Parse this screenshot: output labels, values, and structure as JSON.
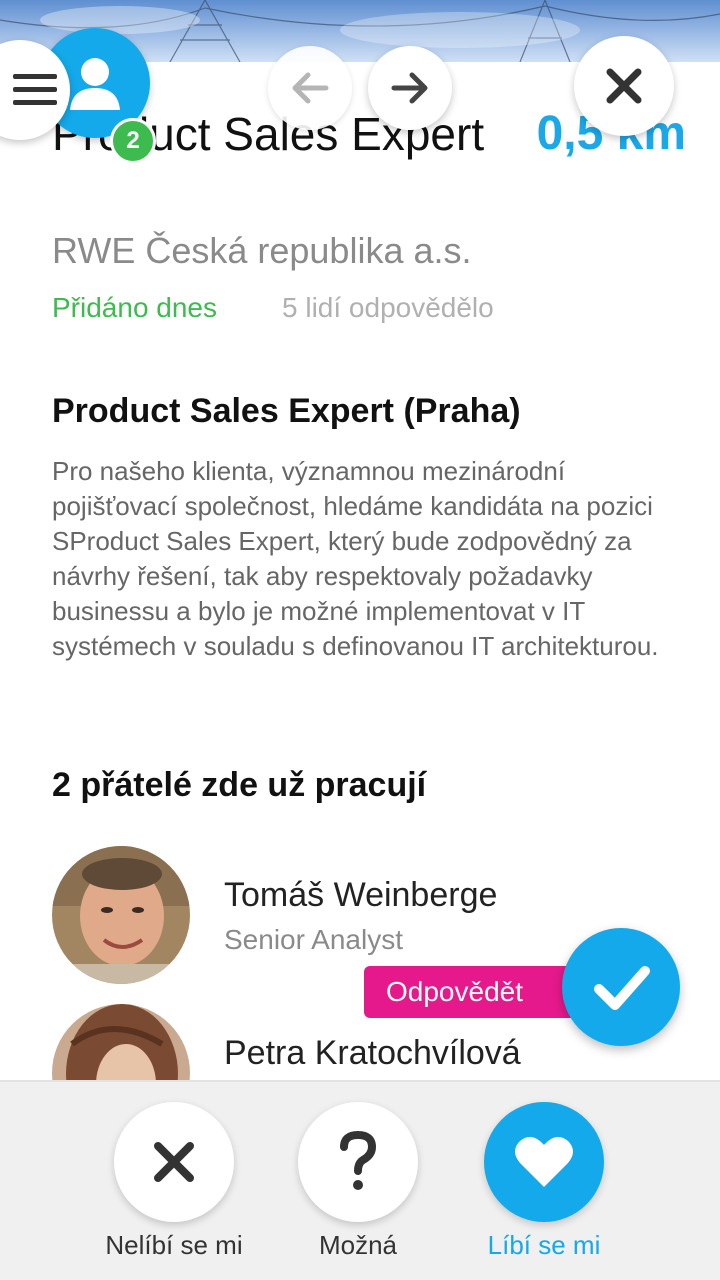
{
  "job": {
    "title": "Product Sales Expert",
    "distance": "0,5 km",
    "company": "RWE Česká republika a.s.",
    "added": "Přidáno dnes",
    "responses": "5 lidí odpovědělo",
    "heading": "Product Sales Expert (Praha)",
    "description": "Pro našeho klienta, významnou mezinárodní pojišťovací společnost, hledáme kandidáta na pozici SProduct Sales Expert, který bude zodpovědný za návrhy řešení, tak aby respektovaly požadavky businessu a bylo je možné implementovat v IT systémech v souladu s definovanou IT architekturou."
  },
  "friends": {
    "heading": "2 přátelé zde už pracují",
    "items": [
      {
        "name": "Tomáš Weinberge",
        "role": "Senior Analyst"
      },
      {
        "name": "Petra Kratochvílová",
        "role": ""
      }
    ]
  },
  "header": {
    "notification_count": "2",
    "icons": [
      "menu-icon",
      "user-icon",
      "arrow-left-icon",
      "arrow-right-icon",
      "close-icon"
    ]
  },
  "actions": {
    "respond_label": "Odpovědět",
    "dislike_label": "Nelíbí se mi",
    "maybe_label": "Možná",
    "like_label": "Líbí se mi"
  },
  "colors": {
    "accent": "#13a9ea",
    "green": "#3dbb4e",
    "magenta": "#e6198c"
  }
}
